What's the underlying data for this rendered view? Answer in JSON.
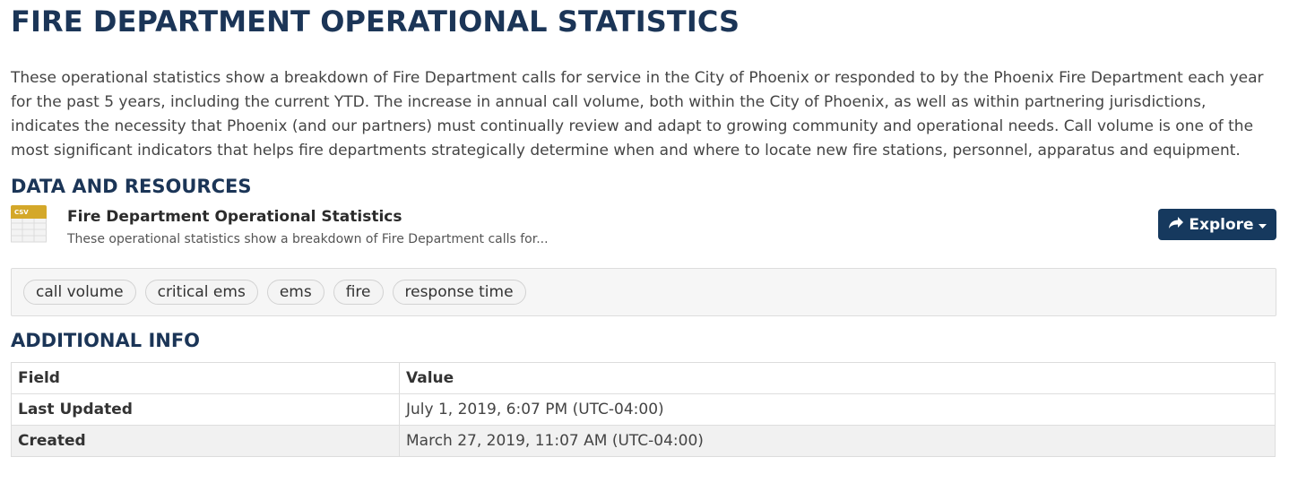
{
  "page": {
    "title": "FIRE DEPARTMENT OPERATIONAL STATISTICS",
    "notes": "These operational statistics show a breakdown of Fire Department calls for service in the City of Phoenix or responded to by the Phoenix Fire Department each year for the past 5 years, including the current YTD. The increase in annual call volume, both within the City of Phoenix, as well as within partnering jurisdictions, indicates the necessity that Phoenix (and our partners) must continually review and adapt to growing community and operational needs. Call volume is one of the most significant indicators that helps fire departments strategically determine when and where to locate new fire stations, personnel, apparatus and equipment."
  },
  "resources": {
    "heading": "DATA AND RESOURCES",
    "items": [
      {
        "format": "CSV",
        "icon": "csv-file-icon",
        "title": "Fire Department Operational Statistics",
        "description": "These operational statistics show a breakdown of Fire Department calls for...",
        "explore_label": "Explore"
      }
    ]
  },
  "tags": [
    "call volume",
    "critical ems",
    "ems",
    "fire",
    "response time"
  ],
  "additional_info": {
    "heading": "ADDITIONAL INFO",
    "columns": [
      "Field",
      "Value"
    ],
    "rows": [
      {
        "field": "Last Updated",
        "value": "July 1, 2019, 6:07 PM (UTC-04:00)"
      },
      {
        "field": "Created",
        "value": "March 27, 2019, 11:07 AM (UTC-04:00)"
      }
    ]
  },
  "colors": {
    "heading": "#1b3557",
    "button": "#16395e",
    "csv_icon": "#d4a82a"
  }
}
